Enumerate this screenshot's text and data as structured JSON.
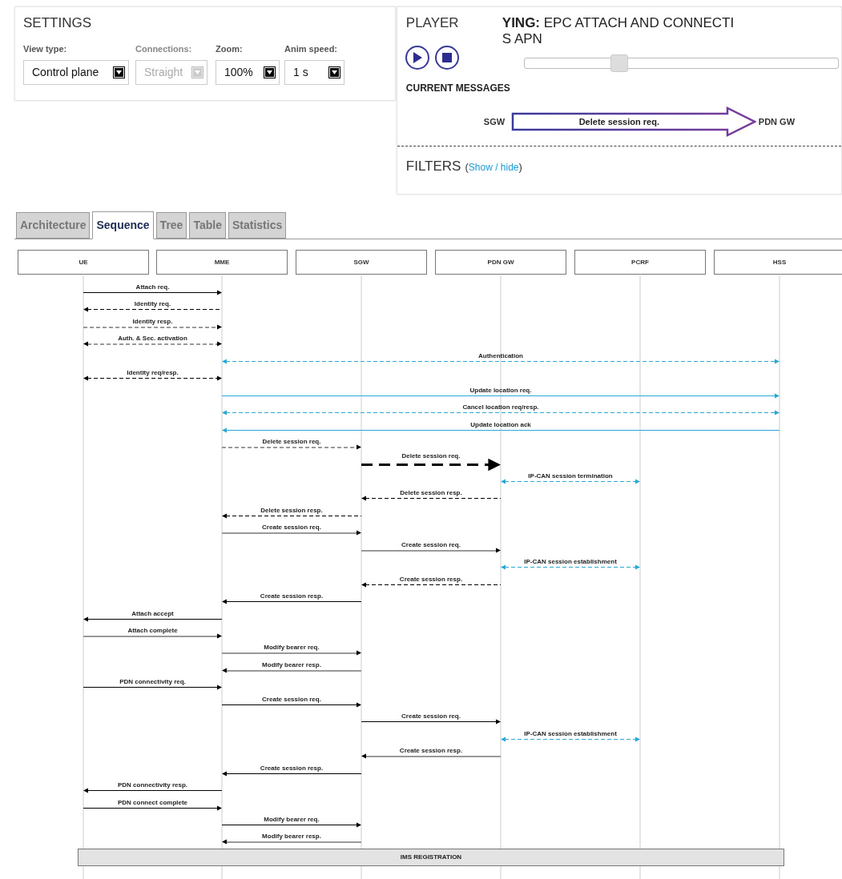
{
  "settings": {
    "title": "SETTINGS",
    "fields": [
      {
        "label": "View type:",
        "value": "Control plane",
        "disabled": false
      },
      {
        "label": "Connections:",
        "value": "Straight",
        "disabled": true
      },
      {
        "label": "Zoom:",
        "value": "100%",
        "disabled": false
      },
      {
        "label": "Anim speed:",
        "value": "1 s",
        "disabled": false
      }
    ]
  },
  "player": {
    "title": "PLAYER",
    "playing_lines": [
      "**YING:** EPC ATTACH AND CONNECTI",
      "S APN"
    ],
    "progress": {
      "level": 0.3
    },
    "current_messages": {
      "title": "CURRENT MESSAGES",
      "from": "SGW",
      "message": "Delete session req.",
      "to": "PDN GW"
    },
    "filters": {
      "title": "FILTERS",
      "link_open": "(",
      "link": "Show / hide",
      "link_close": ")"
    }
  },
  "tabs": [
    {
      "label": "Architecture",
      "selected": false
    },
    {
      "label": "Sequence",
      "selected": true
    },
    {
      "label": "Tree",
      "selected": false
    },
    {
      "label": "Table",
      "selected": false
    },
    {
      "label": "Statistics",
      "selected": false
    }
  ],
  "participants": [
    "UE",
    "MME",
    "SGW",
    "PDN GW",
    "PCRF",
    "HSS"
  ],
  "messages": [
    {
      "label": "Attach req.",
      "kind": "ue-mme",
      "bidirectional": false,
      "dashed": false,
      "color": "#000000",
      "current": false
    },
    {
      "label": "Identity req.",
      "kind": "mme-ue",
      "bidirectional": false,
      "dashed": true,
      "color": "#000000",
      "current": false
    },
    {
      "label": "Identity resp.",
      "kind": "ue-mme",
      "bidirectional": false,
      "dashed": true,
      "color": "#999999",
      "current": false
    },
    {
      "label": "Auth. & Sec. activation",
      "kind": "ue-mme",
      "bidirectional": true,
      "dashed": true,
      "color": "#999999",
      "current": false
    },
    {
      "label": "Authentication",
      "kind": "mme-hss",
      "bidirectional": true,
      "dashed": true,
      "color": "#29a8d8",
      "current": false
    },
    {
      "label": "Identity req/resp.",
      "kind": "ue-mme",
      "bidirectional": true,
      "dashed": true,
      "color": "#000000",
      "current": false
    },
    {
      "label": "Update location req.",
      "kind": "mme-hss",
      "bidirectional": false,
      "dashed": false,
      "color": "#29a8d8",
      "current": false
    },
    {
      "label": "Cancel location req/resp.",
      "kind": "mme-hss",
      "bidirectional": true,
      "dashed": true,
      "color": "#29a8d8",
      "current": false
    },
    {
      "label": "Update location ack",
      "kind": "hss-mme",
      "bidirectional": false,
      "dashed": false,
      "color": "#29a8d8",
      "current": false
    },
    {
      "label": "Delete session req.",
      "kind": "mme-sgw",
      "bidirectional": false,
      "dashed": true,
      "color": "#999999",
      "current": false
    },
    {
      "label": "Delete session req.",
      "kind": "sgw-pdngw",
      "bidirectional": false,
      "dashed": true,
      "color": "#000000",
      "current": true
    },
    {
      "label": "IP-CAN session termination",
      "kind": "pdngw-pcrf",
      "bidirectional": true,
      "dashed": true,
      "color": "#29a8d8",
      "current": false
    },
    {
      "label": "Delete session resp.",
      "kind": "pdngw-sgw",
      "bidirectional": false,
      "dashed": true,
      "color": "#000000",
      "current": false
    },
    {
      "label": "Delete session resp.",
      "kind": "sgw-mme",
      "bidirectional": false,
      "dashed": true,
      "color": "#000000",
      "current": false
    },
    {
      "label": "Create session req.",
      "kind": "mme-sgw",
      "bidirectional": false,
      "dashed": false,
      "color": "#999999",
      "current": false
    },
    {
      "label": "Create session req.",
      "kind": "sgw-pdngw",
      "bidirectional": false,
      "dashed": false,
      "color": "#999999",
      "current": false
    },
    {
      "label": "IP-CAN session establishment",
      "kind": "pdngw-pcrf",
      "bidirectional": true,
      "dashed": true,
      "color": "#29a8d8",
      "current": false
    },
    {
      "label": "Create session resp.",
      "kind": "pdngw-sgw",
      "bidirectional": false,
      "dashed": true,
      "color": "#000000",
      "current": false
    },
    {
      "label": "Create session resp.",
      "kind": "sgw-mme",
      "bidirectional": false,
      "dashed": false,
      "color": "#000000",
      "current": false
    },
    {
      "label": "Attach accept",
      "kind": "mme-ue",
      "bidirectional": false,
      "dashed": false,
      "color": "#000000",
      "current": false
    },
    {
      "label": "Attach complete",
      "kind": "ue-mme",
      "bidirectional": false,
      "dashed": false,
      "color": "#999999",
      "current": false
    },
    {
      "label": "Modify bearer req.",
      "kind": "mme-sgw",
      "bidirectional": false,
      "dashed": false,
      "color": "#999999",
      "current": false
    },
    {
      "label": "Modify bearer resp.",
      "kind": "sgw-mme",
      "bidirectional": false,
      "dashed": false,
      "color": "#999999",
      "current": false
    },
    {
      "label": "PDN connectivity req.",
      "kind": "ue-mme",
      "bidirectional": false,
      "dashed": false,
      "color": "#000000",
      "current": false
    },
    {
      "label": "Create session req.",
      "kind": "mme-sgw",
      "bidirectional": false,
      "dashed": false,
      "color": "#000000",
      "current": false
    },
    {
      "label": "Create session req.",
      "kind": "sgw-pdngw",
      "bidirectional": false,
      "dashed": false,
      "color": "#000000",
      "current": false
    },
    {
      "label": "IP-CAN session establishment",
      "kind": "pdngw-pcrf",
      "bidirectional": true,
      "dashed": true,
      "color": "#29a8d8",
      "current": false
    },
    {
      "label": "Create session resp.",
      "kind": "pdngw-sgw",
      "bidirectional": false,
      "dashed": false,
      "color": "#999999",
      "current": false
    },
    {
      "label": "Create session resp.",
      "kind": "sgw-mme",
      "bidirectional": false,
      "dashed": false,
      "color": "#000000",
      "current": false
    },
    {
      "label": "PDN connectivity resp.",
      "kind": "mme-ue",
      "bidirectional": false,
      "dashed": false,
      "color": "#000000",
      "current": false
    },
    {
      "label": "PDN connect complete",
      "kind": "ue-mme",
      "bidirectional": false,
      "dashed": false,
      "color": "#000000",
      "current": false
    },
    {
      "label": "Modify bearer req.",
      "kind": "mme-sgw",
      "bidirectional": false,
      "dashed": false,
      "color": "#000000",
      "current": false
    },
    {
      "label": "Modify bearer resp.",
      "kind": "sgw-mme",
      "bidirectional": false,
      "dashed": false,
      "color": "#999999",
      "current": false
    }
  ],
  "phase_bar": "IMS REGISTRATION"
}
